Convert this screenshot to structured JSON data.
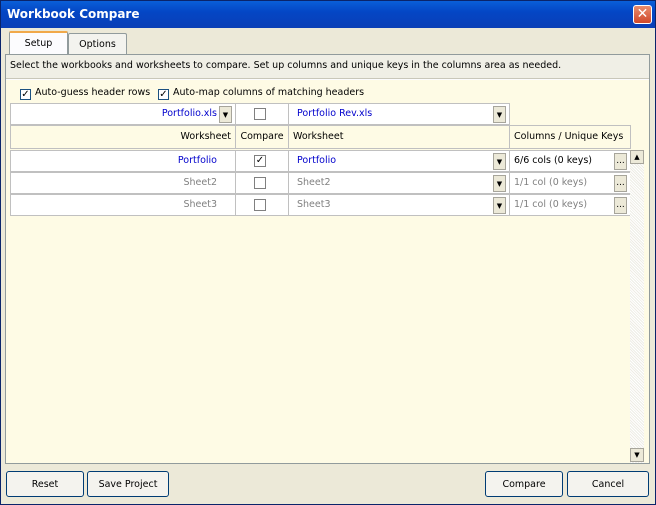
{
  "window": {
    "title": "Workbook Compare",
    "close": "✕"
  },
  "tabs": [
    {
      "label": "Setup"
    },
    {
      "label": "Options"
    }
  ],
  "instructions": "Select the workbooks and worksheets to compare. Set up columns and unique keys in the columns area as needed.",
  "options": {
    "auto_guess": "Auto-guess header rows",
    "auto_guess_checked": true,
    "auto_map": "Auto-map columns of matching headers",
    "auto_map_checked": true
  },
  "workbooks": {
    "left": "Portfolio.xls",
    "right": "Portfolio Rev.xls",
    "compare_all_checked": false
  },
  "headers": {
    "worksheet_left": "Worksheet",
    "compare": "Compare",
    "worksheet_right": "Worksheet",
    "columns_keys": "Columns / Unique Keys"
  },
  "rows": [
    {
      "left": "Portfolio",
      "compare": true,
      "right": "Portfolio",
      "keys": "6/6 cols (0  keys)",
      "active": true
    },
    {
      "left": "Sheet2",
      "compare": false,
      "right": "Sheet2",
      "keys": "1/1 col (0  keys)",
      "active": false
    },
    {
      "left": "Sheet3",
      "compare": false,
      "right": "Sheet3",
      "keys": "1/1 col (0  keys)",
      "active": false
    }
  ],
  "glyphs": {
    "check": "✓",
    "dropdown": "▼",
    "up": "▲",
    "ellipsis": "..."
  },
  "buttons": {
    "reset": "Reset",
    "save_project": "Save Project",
    "compare": "Compare",
    "cancel": "Cancel"
  }
}
